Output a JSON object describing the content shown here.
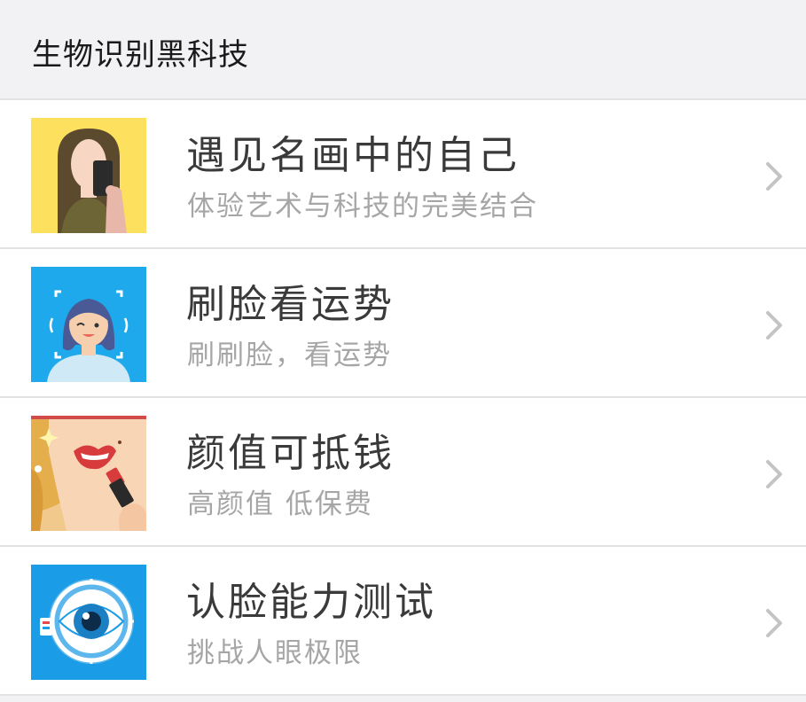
{
  "header": {
    "title": "生物识别黑科技"
  },
  "items": [
    {
      "title": "遇见名画中的自己",
      "subtitle": "体验艺术与科技的完美结合",
      "icon": "mona-lisa-selfie-icon",
      "bg": "#fde05e"
    },
    {
      "title": "刷脸看运势",
      "subtitle": "刷刷脸，看运势",
      "icon": "face-scan-fortune-icon",
      "bg": "#1ea9ec"
    },
    {
      "title": "颜值可抵钱",
      "subtitle": "高颜值 低保费",
      "icon": "lipstick-face-icon",
      "bg": "#f2c98d"
    },
    {
      "title": "认脸能力测试",
      "subtitle": "挑战人眼极限",
      "icon": "eye-scan-icon",
      "bg": "#1b9ce6"
    }
  ],
  "colors": {
    "background": "#f2f2f4",
    "row": "#ffffff",
    "title": "#3a3a3a",
    "subtitle": "#a6a6a6",
    "chevron": "#c4c4c6"
  }
}
